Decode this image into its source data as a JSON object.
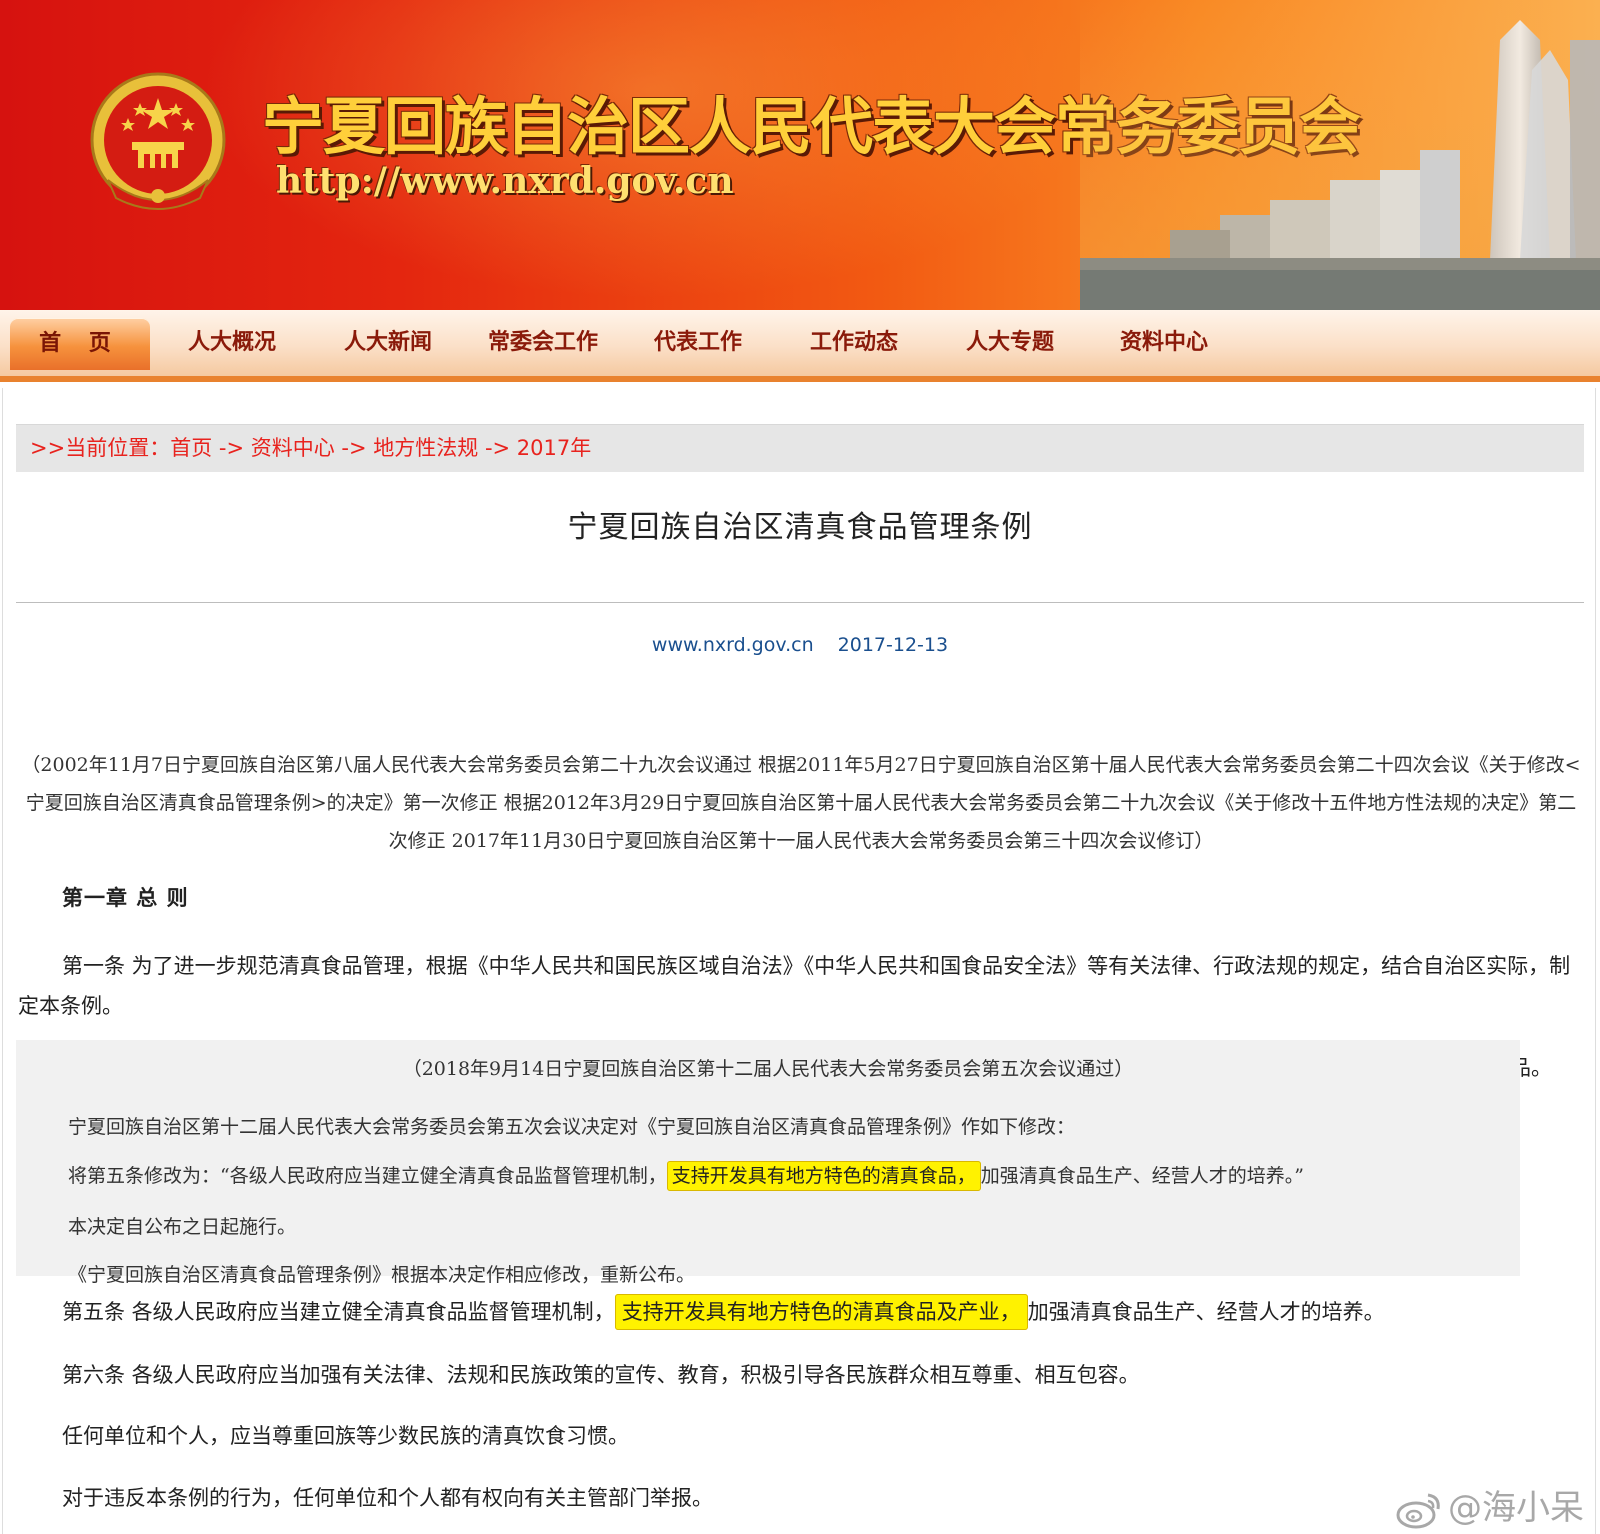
{
  "banner": {
    "title": "宁夏回族自治区人民代表大会常务委员会",
    "url": "http://www.nxrd.gov.cn"
  },
  "nav": {
    "items": [
      "首 页",
      "人大概况",
      "人大新闻",
      "常委会工作",
      "代表工作",
      "工作动态",
      "人大专题",
      "资料中心"
    ],
    "active": "首 页"
  },
  "breadcrumb": {
    "prefix": ">>当前位置：",
    "home": "首页",
    "sep": " -> ",
    "items": [
      "资料中心",
      "地方性法规",
      "2017年"
    ]
  },
  "article": {
    "title": "宁夏回族自治区清真食品管理条例",
    "source": "www.nxrd.gov.cn",
    "date": "2017-12-13",
    "preamble": "（2002年11月7日宁夏回族自治区第八届人民代表大会常务委员会第二十九次会议通过 根据2011年5月27日宁夏回族自治区第十届人民代表大会常务委员会第二十四次会议《关于修改<宁夏回族自治区清真食品管理条例>的决定》第一次修正 根据2012年3月29日宁夏回族自治区第十届人民代表大会常务委员会第二十九次会议《关于修改十五件地方性法规的决定》第二次修正 2017年11月30日宁夏回族自治区第十一届人民代表大会常务委员会第三十四次会议修订）",
    "chapter": "第一章 总 则",
    "article1": "第一条 为了进一步规范清真食品管理，根据《中华人民共和国民族区域自治法》《中华人民共和国食品安全法》等有关法律、行政法规的规定，结合自治区实际，制定本条例。",
    "truncated_tail": "品。",
    "article5_pre": "第五条 各级人民政府应当建立健全清真食品监督管理机制，",
    "article5_hl": "支持开发具有地方特色的清真食品及产业，",
    "article5_post": "加强清真食品生产、经营人才的培养。",
    "article6": "第六条 各级人民政府应当加强有关法律、法规和民族政策的宣传、教育，积极引导各民族群众相互尊重、相互包容。",
    "para_a": "任何单位和个人，应当尊重回族等少数民族的清真饮食习惯。",
    "para_b": "对于违反本条例的行为，任何单位和个人都有权向有关主管部门举报。"
  },
  "overlay": {
    "header": "（2018年9月14日宁夏回族自治区第十二届人民代表大会常务委员会第五次会议通过）",
    "line1": "宁夏回族自治区第十二届人民代表大会常务委员会第五次会议决定对《宁夏回族自治区清真食品管理条例》作如下修改：",
    "line2_pre": "将第五条修改为：“各级人民政府应当建立健全清真食品监督管理机制，",
    "line2_hl": "支持开发具有地方特色的清真食品，",
    "line2_post": "加强清真食品生产、经营人才的培养。”",
    "line3": "本决定自公布之日起施行。",
    "line4": "《宁夏回族自治区清真食品管理条例》根据本决定作相应修改，重新公布。"
  },
  "watermark": {
    "text": "@海小呆",
    "icon": "weibo-icon"
  },
  "colors": {
    "banner_red": "#d6120f",
    "banner_orange": "#f98a25",
    "nav_text": "#8a1a0a",
    "breadcrumb_text": "#e8231e",
    "meta_blue": "#1a4f8e",
    "highlight": "#fff200"
  }
}
